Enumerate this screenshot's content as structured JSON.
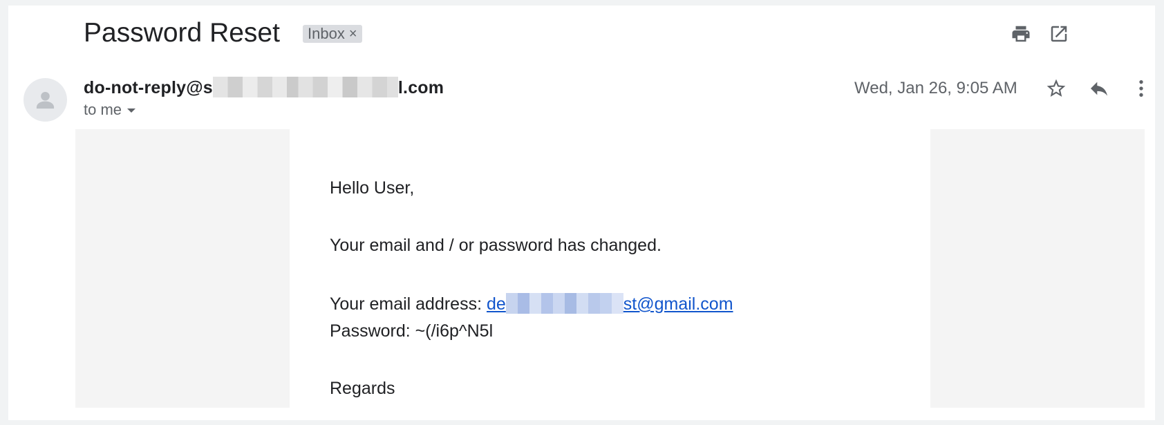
{
  "email": {
    "subject": "Password Reset",
    "label": "Inbox",
    "label_close": "×",
    "sender_prefix": "do-not-reply@s",
    "sender_suffix": "l.com",
    "recipient": "to me",
    "date": "Wed, Jan 26, 9:05 AM",
    "body": {
      "greeting": "Hello User,",
      "notice": "Your email and / or password has changed.",
      "address_label": "Your email address: ",
      "address_link_prefix": "de",
      "address_link_suffix": "st@gmail.com",
      "password_line": "Password: ~(/i6p^N5l",
      "signoff": "Regards"
    }
  },
  "icons": {
    "print": "print-icon",
    "open_new_window": "open-in-new-window-icon",
    "star": "star-icon",
    "reply": "reply-icon",
    "more": "more-vertical-icon",
    "avatar": "default-avatar-icon"
  },
  "colors": {
    "link": "#1155cc",
    "text": "#202124",
    "secondary_text": "#5f6368",
    "label_bg": "#dadce0"
  }
}
